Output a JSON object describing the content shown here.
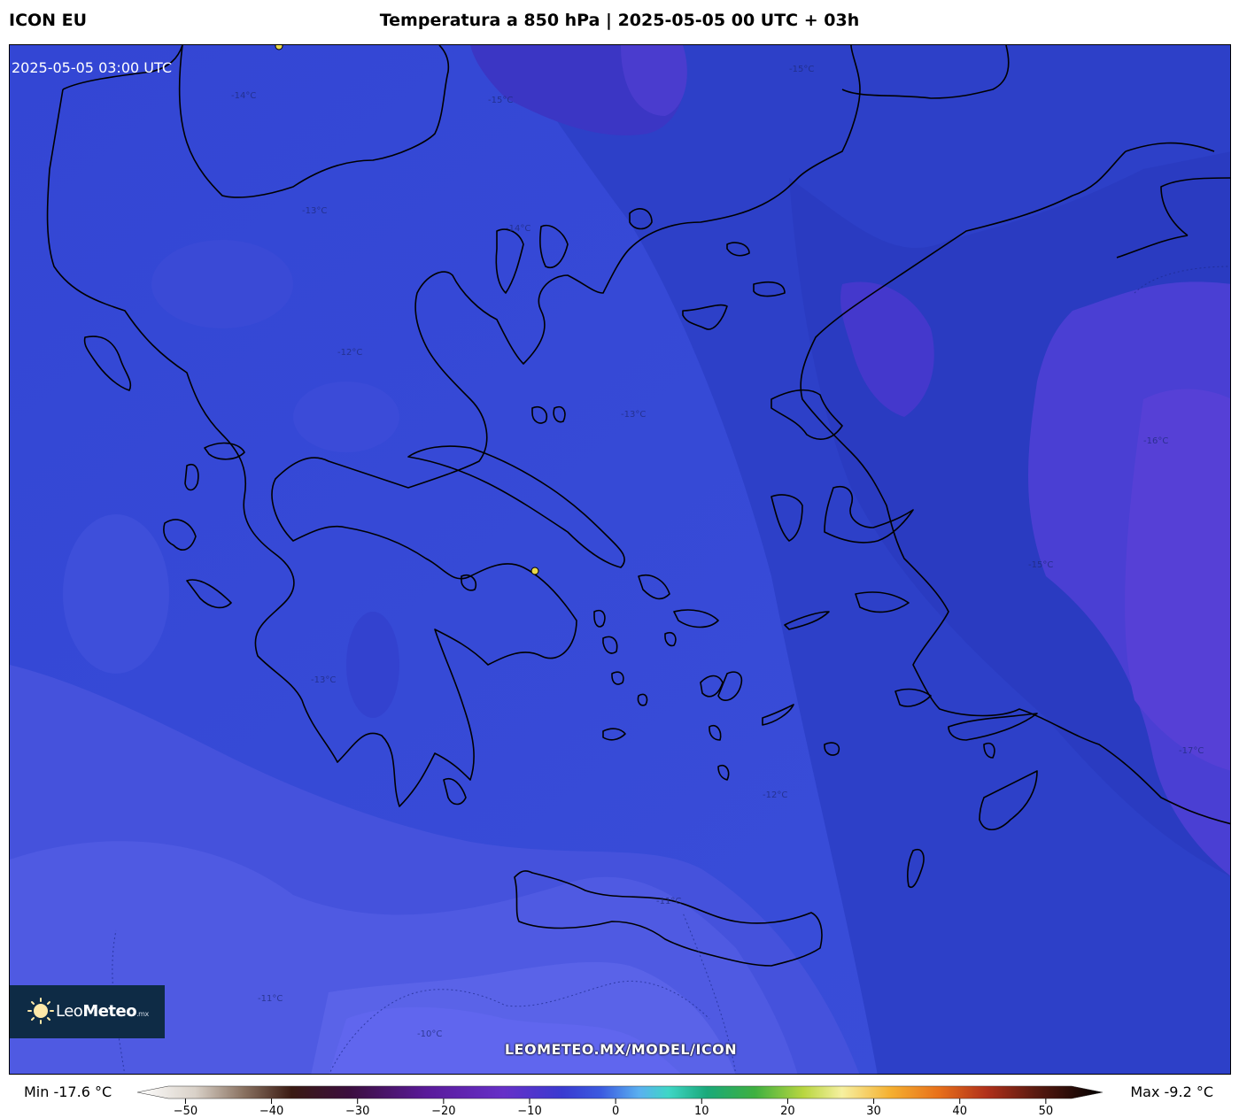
{
  "header": {
    "model": "ICON EU",
    "title": "Temperatura a 850 hPa | 2025-05-05 00 UTC + 03h"
  },
  "map": {
    "valid_time": "2025-05-05 03:00 UTC",
    "watermark": "LEOMETEO.MX/MODEL/ICON",
    "contour_labels": [
      "-15°C",
      "-14°C",
      "-13°C",
      "-12°C",
      "-11°C",
      "-10°C",
      "-16°C",
      "-17°C"
    ],
    "colors": {
      "land_line": "#000000",
      "city_marker": "#e8d84a"
    }
  },
  "logo": {
    "name_light": "Leo",
    "name_bold": "Meteo",
    "suffix": ".mx"
  },
  "legend": {
    "min_label": "Min -17.6 °C",
    "max_label": "Max -9.2 °C",
    "ticks": [
      "−50",
      "−40",
      "−30",
      "−20",
      "−10",
      "0",
      "10",
      "20",
      "30",
      "40",
      "50"
    ],
    "tick_values": [
      -50,
      -40,
      -30,
      -20,
      -10,
      0,
      10,
      20,
      30,
      40,
      50
    ],
    "range": [
      -52,
      53
    ]
  }
}
